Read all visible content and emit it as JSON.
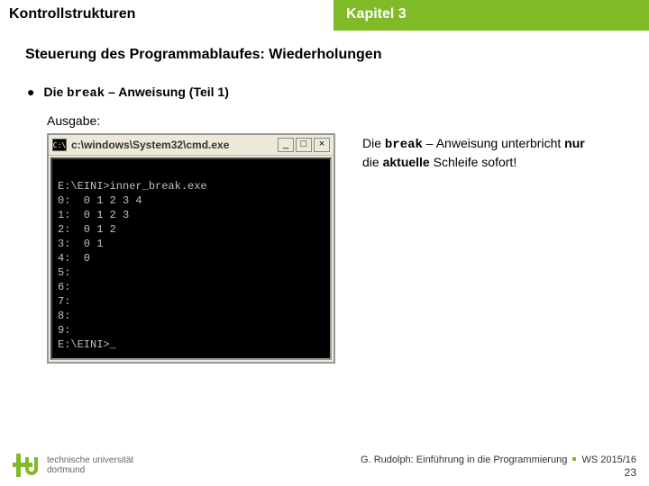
{
  "header": {
    "left": "Kontrollstrukturen",
    "right": "Kapitel 3"
  },
  "section_title": "Steuerung des Programmablaufes: Wiederholungen",
  "bullet": {
    "pre": "Die ",
    "code": "break",
    "post": " – Anweisung (Teil 1)"
  },
  "output_label": "Ausgabe:",
  "cmd": {
    "title": "c:\\windows\\System32\\cmd.exe",
    "icon_glyph": "C:\\",
    "btn_min": "_",
    "btn_max": "□",
    "btn_close": "×",
    "lines": [
      "",
      "E:\\EINI>inner_break.exe",
      "0:  0 1 2 3 4",
      "1:  0 1 2 3",
      "2:  0 1 2",
      "3:  0 1",
      "4:  0",
      "5:",
      "6:",
      "7:",
      "8:",
      "9:",
      "E:\\EINI>_"
    ]
  },
  "note": {
    "pre": "Die ",
    "code": "break",
    "mid": " – Anweisung unterbricht ",
    "strong1": "nur",
    "mid2": " die ",
    "strong2": "aktuelle",
    "post": " Schleife sofort!"
  },
  "footer": {
    "uni1": "technische universität",
    "uni2": "dortmund",
    "author": "G. Rudolph: Einführung in die Programmierung",
    "term": "WS 2015/16",
    "slide": "23"
  }
}
